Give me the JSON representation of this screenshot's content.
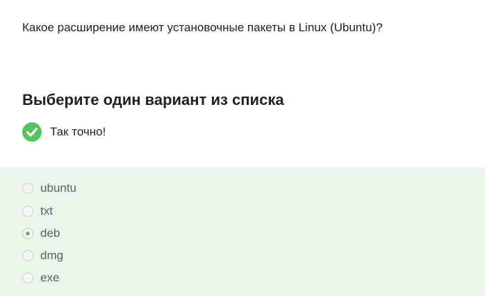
{
  "question": {
    "text": "Какое расширение имеют установочные пакеты в Linux (Ubuntu)?"
  },
  "choice_block": {
    "heading": "Выберите один вариант из списка",
    "feedback": {
      "icon": "check-circle-icon",
      "text": "Так точно!",
      "color": "#57c35f"
    },
    "panel_color": "#e8f7ea",
    "options": [
      {
        "label": "ubuntu",
        "selected": false
      },
      {
        "label": "txt",
        "selected": false
      },
      {
        "label": "deb",
        "selected": true
      },
      {
        "label": "dmg",
        "selected": false
      },
      {
        "label": "exe",
        "selected": false
      }
    ]
  }
}
